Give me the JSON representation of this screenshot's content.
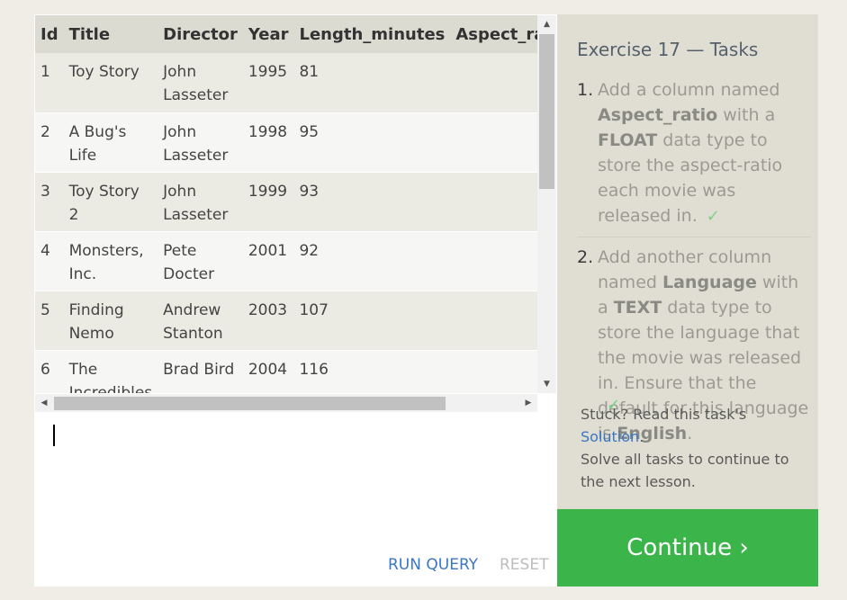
{
  "table": {
    "columns": [
      "Id",
      "Title",
      "Director",
      "Year",
      "Length_minutes",
      "Aspect_ratio"
    ],
    "rows": [
      {
        "id": "1",
        "title": "Toy Story",
        "director": "John Lasseter",
        "year": "1995",
        "length": "81",
        "aspect": ""
      },
      {
        "id": "2",
        "title": "A Bug's Life",
        "director": "John Lasseter",
        "year": "1998",
        "length": "95",
        "aspect": ""
      },
      {
        "id": "3",
        "title": "Toy Story 2",
        "director": "John Lasseter",
        "year": "1999",
        "length": "93",
        "aspect": ""
      },
      {
        "id": "4",
        "title": "Monsters, Inc.",
        "director": "Pete Docter",
        "year": "2001",
        "length": "92",
        "aspect": ""
      },
      {
        "id": "5",
        "title": "Finding Nemo",
        "director": "Andrew Stanton",
        "year": "2003",
        "length": "107",
        "aspect": ""
      },
      {
        "id": "6",
        "title": "The Incredibles",
        "director": "Brad Bird",
        "year": "2004",
        "length": "116",
        "aspect": ""
      }
    ]
  },
  "editor": {
    "run_label": "RUN QUERY",
    "reset_label": "RESET"
  },
  "tasks": {
    "title": "Exercise 17 — Tasks",
    "items": [
      {
        "num": "1.",
        "parts": [
          "Add a column named ",
          "Aspect_ratio",
          " with a ",
          "FLOAT",
          " data type to store the aspect-ratio each movie was released in."
        ],
        "done_mark": "✓"
      },
      {
        "num": "2.",
        "parts": [
          "Add another column named ",
          "Language",
          " with a ",
          "TEXT",
          " data type to store the language that the movie was released in. Ensure that the default for this language is ",
          "English",
          "."
        ],
        "done_mark": "✓"
      }
    ],
    "stuck_prefix": "Stuck? Read this task's",
    "solution_label": "Solution",
    "stuck_suffix": "Solve all tasks to continue to the next lesson.",
    "continue_label": "Continue ›"
  },
  "colors": {
    "accent_green": "#3bb54a",
    "link_blue": "#3a76c6",
    "check_green": "#7fcf8a"
  }
}
